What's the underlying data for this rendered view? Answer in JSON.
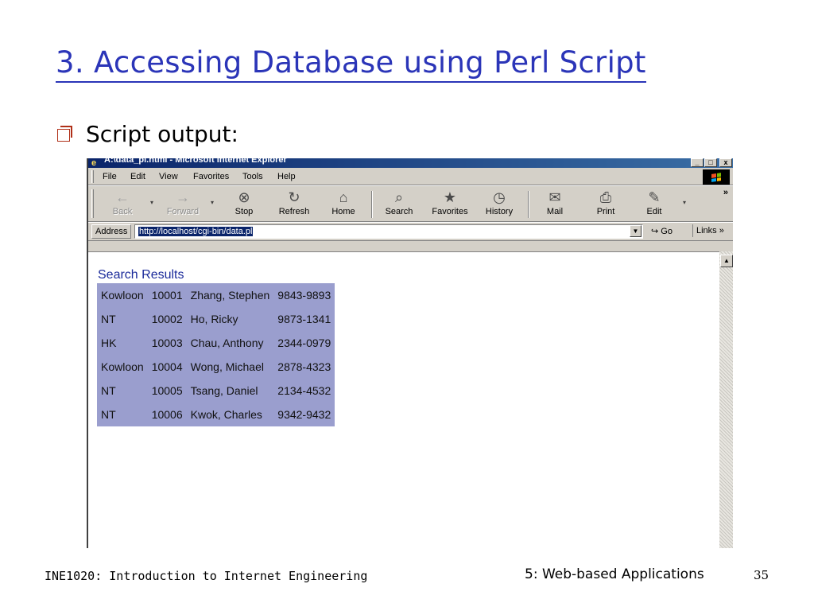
{
  "slide": {
    "title": "3. Accessing Database using Perl Script",
    "bullet": "Script output:"
  },
  "browser": {
    "window_title": "A:\\data_pl.html - Microsoft Internet Explorer",
    "window_buttons": [
      "_",
      "□",
      "x"
    ],
    "menu": [
      "File",
      "Edit",
      "View",
      "Favorites",
      "Tools",
      "Help"
    ],
    "toolbar": [
      {
        "label": "Back",
        "icon": "back-arrow-icon",
        "disabled": true
      },
      {
        "label": "Forward",
        "icon": "forward-arrow-icon",
        "disabled": true
      },
      {
        "label": "Stop",
        "icon": "stop-icon"
      },
      {
        "label": "Refresh",
        "icon": "refresh-icon"
      },
      {
        "label": "Home",
        "icon": "home-icon"
      },
      {
        "label": "Search",
        "icon": "search-icon"
      },
      {
        "label": "Favorites",
        "icon": "favorites-icon"
      },
      {
        "label": "History",
        "icon": "history-icon"
      },
      {
        "label": "Mail",
        "icon": "mail-icon"
      },
      {
        "label": "Print",
        "icon": "print-icon"
      },
      {
        "label": "Edit",
        "icon": "edit-icon"
      }
    ],
    "address_label": "Address",
    "address_url": "http://localhost/cgi-bin/data.pl",
    "go_label": "Go",
    "links_label": "Links",
    "chevron": "»"
  },
  "page": {
    "heading": "Search Results",
    "rows": [
      [
        "Kowloon",
        "10001",
        "Zhang, Stephen",
        "9843-9893"
      ],
      [
        "NT",
        "10002",
        "Ho, Ricky",
        "9873-1341"
      ],
      [
        "HK",
        "10003",
        "Chau, Anthony",
        "2344-0979"
      ],
      [
        "Kowloon",
        "10004",
        "Wong, Michael",
        "2878-4323"
      ],
      [
        "NT",
        "10005",
        "Tsang, Daniel",
        "2134-4532"
      ],
      [
        "NT",
        "10006",
        "Kwok, Charles",
        "9342-9432"
      ]
    ]
  },
  "footer": {
    "course": "INE1020: Introduction to Internet Engineering",
    "section": "5: Web-based Applications",
    "page_number": "35"
  },
  "colors": {
    "title": "#2b35b8",
    "table_bg": "#9a9ece",
    "bullet": "#b03018"
  }
}
